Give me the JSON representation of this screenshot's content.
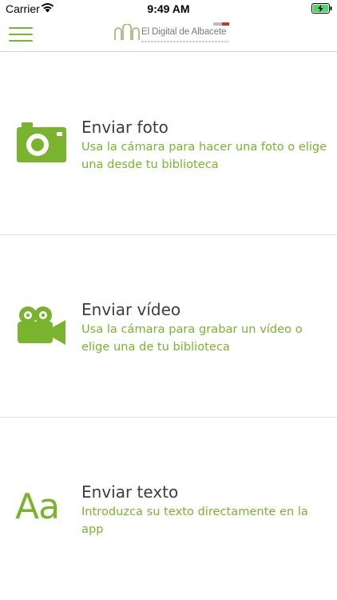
{
  "status_bar": {
    "carrier": "Carrier",
    "time": "9:49 AM",
    "wifi_icon": "wifi-icon",
    "battery_icon": "battery-charging-icon"
  },
  "nav": {
    "menu_icon": "hamburger-menu-icon",
    "logo_text": "El Digital de Albacete"
  },
  "colors": {
    "accent": "#7ab32e",
    "title": "#3d3d3d",
    "divider": "#e3e3e3"
  },
  "options": [
    {
      "icon": "camera-icon",
      "title": "Enviar foto",
      "description": "Usa la cámara para hacer una foto o elige una desde tu biblioteca"
    },
    {
      "icon": "video-camera-icon",
      "title": "Enviar vídeo",
      "description": "Usa la cámara para grabar un vídeo o elige una de tu biblioteca"
    },
    {
      "icon": "text-icon",
      "icon_text": "Aa",
      "title": "Enviar texto",
      "description": "Introduzca su texto directamente en la app"
    }
  ]
}
